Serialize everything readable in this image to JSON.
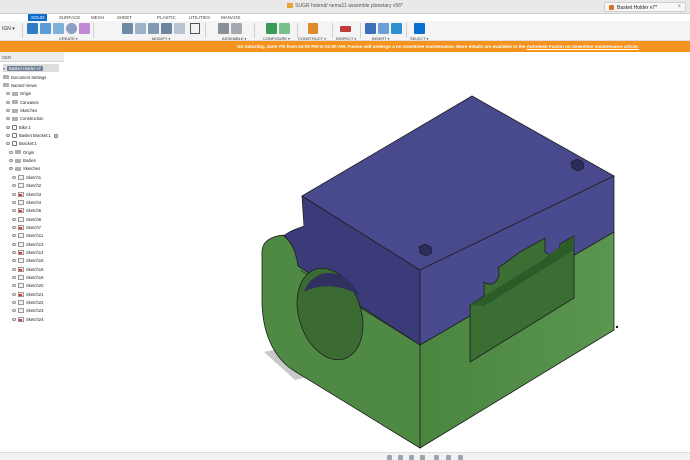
{
  "window": {
    "title": "SUGR hotend/ nema11 assemble planetary v56*"
  },
  "document_tab": {
    "label": "Basket Holder v7*",
    "close_glyph": "×"
  },
  "workspace_tabs": [
    {
      "label": "SOLID",
      "active": true
    },
    {
      "label": "SURFACE",
      "active": false
    },
    {
      "label": "MESH",
      "active": false
    },
    {
      "label": "SHEET METAL",
      "active": false
    },
    {
      "label": "PLASTIC",
      "active": false
    },
    {
      "label": "UTILITIES",
      "active": false
    },
    {
      "label": "MANAGE",
      "active": false
    }
  ],
  "toolbar": {
    "design_mode": "IGN ▾",
    "groups": [
      {
        "label": "CREATE"
      },
      {
        "label": "MODIFY"
      },
      {
        "label": "ASSEMBLE"
      },
      {
        "label": "CONFIGURE"
      },
      {
        "label": "CONSTRUCT"
      },
      {
        "label": "INSPECT"
      },
      {
        "label": "INSERT"
      },
      {
        "label": "SELECT"
      }
    ],
    "icon_colors": {
      "create": "#2d7ec4",
      "modify": "#6f8aa6",
      "assemble": "#8a8f96",
      "configure": "#3a9a57",
      "construct": "#e08a2e",
      "inspect": "#c33a3a",
      "insert": "#3d6fb6",
      "select": "#0a6ed1"
    }
  },
  "banner": {
    "text": "On Saturday, June 7th from 04:00 PM to 01:00 AM, Fusion will undergo a no downtime maintenance. More details are available in the ",
    "link": "Autodesk Fusion no downtime maintenance article."
  },
  "browser": {
    "header": "SER",
    "root": "Basket Holder v7",
    "items": [
      {
        "label": "Document Settings",
        "type": "folder",
        "indent": 0
      },
      {
        "label": "Named Views",
        "type": "folder",
        "indent": 0
      },
      {
        "label": "Origin",
        "type": "folder",
        "indent": 1
      },
      {
        "label": "Canvases",
        "type": "folder",
        "indent": 1
      },
      {
        "label": "Sketches",
        "type": "folder",
        "indent": 1
      },
      {
        "label": "Construction",
        "type": "folder",
        "indent": 1
      },
      {
        "label": "Bike:1",
        "type": "component",
        "indent": 1
      },
      {
        "label": "Basket Bracket:1",
        "type": "component",
        "indent": 1
      },
      {
        "label": "Bracket:1",
        "type": "component",
        "indent": 1
      },
      {
        "label": "Origin",
        "type": "folder",
        "indent": 2
      },
      {
        "label": "Bodies",
        "type": "folder",
        "indent": 2
      },
      {
        "label": "Sketches",
        "type": "folder",
        "indent": 2
      },
      {
        "label": "Sketch1",
        "type": "sketch",
        "indent": 3
      },
      {
        "label": "Sketch2",
        "type": "sketch",
        "indent": 3
      },
      {
        "label": "Sketch3",
        "type": "sketch-red",
        "indent": 3
      },
      {
        "label": "Sketch4",
        "type": "sketch",
        "indent": 3
      },
      {
        "label": "Sketch5",
        "type": "sketch-red",
        "indent": 3
      },
      {
        "label": "Sketch6",
        "type": "sketch",
        "indent": 3
      },
      {
        "label": "Sketch7",
        "type": "sketch-red",
        "indent": 3
      },
      {
        "label": "Sketch11",
        "type": "sketch",
        "indent": 3
      },
      {
        "label": "Sketch13",
        "type": "sketch",
        "indent": 3
      },
      {
        "label": "Sketch14",
        "type": "sketch-red",
        "indent": 3
      },
      {
        "label": "Sketch16",
        "type": "sketch",
        "indent": 3
      },
      {
        "label": "Sketch18",
        "type": "sketch-red",
        "indent": 3
      },
      {
        "label": "Sketch19",
        "type": "sketch",
        "indent": 3
      },
      {
        "label": "Sketch20",
        "type": "sketch",
        "indent": 3
      },
      {
        "label": "Sketch21",
        "type": "sketch-red",
        "indent": 3
      },
      {
        "label": "Sketch22",
        "type": "sketch",
        "indent": 3
      },
      {
        "label": "Sketch23",
        "type": "sketch",
        "indent": 3
      },
      {
        "label": "Sketch24",
        "type": "sketch-red",
        "indent": 3
      }
    ]
  },
  "model": {
    "top_color": "#494a8d",
    "top_face_color": "#3f4082",
    "side_color": "#3a3b78",
    "green_color": "#4f8a45",
    "green_dark": "#3f7436",
    "edge_color": "#1e1e1e"
  }
}
